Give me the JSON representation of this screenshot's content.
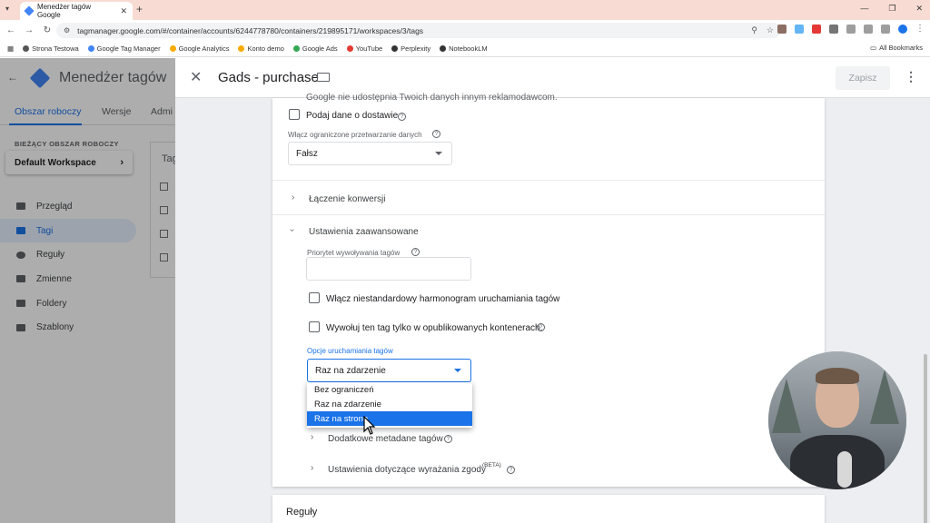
{
  "browser": {
    "tab_title": "Menedżer tagów Google",
    "url": "tagmanager.google.com/#/container/accounts/6244778780/containers/219895171/workspaces/3/tags",
    "bookmarks": [
      "Strona Testowa",
      "Google Tag Manager",
      "Google Analytics",
      "Konto demo",
      "Google Ads",
      "YouTube",
      "Perplexity",
      "NotebookLM"
    ],
    "all_bookmarks": "All Bookmarks"
  },
  "gtm": {
    "app_title": "Menedżer tagów",
    "tabs": [
      "Obszar roboczy",
      "Wersje",
      "Admi"
    ],
    "workspace_label": "BIEŻĄCY OBSZAR ROBOCZY",
    "workspace_name": "Default Workspace",
    "nav": [
      "Przegląd",
      "Tagi",
      "Reguły",
      "Zmienne",
      "Foldery",
      "Szablony"
    ],
    "tags_panel_title": "Tag"
  },
  "drawer": {
    "title": "Gads - purchase",
    "save_label": "Zapisz",
    "cut_text": "Google nie udostępnia Twoich danych innym reklamodawcom.",
    "delivery_label": "Podaj dane o dostawie",
    "restricted_label": "Włącz ograniczone przetwarzanie danych",
    "restricted_value": "Fałsz",
    "conversion_linking": "Łączenie konwersji",
    "advanced_settings": "Ustawienia zaawansowane",
    "priority_label": "Priorytet wywoływania tagów",
    "custom_schedule": "Włącz niestandardowy harmonogram uruchamiania tagów",
    "published_only": "Wywołuj ten tag tylko w opublikowanych kontenerach.",
    "firing_options_label": "Opcje uruchamiania tagów",
    "firing_options_value": "Raz na zdarzenie",
    "dropdown_options": [
      "Bez ograniczeń",
      "Raz na zdarzenie",
      "Raz na stronę"
    ],
    "additional_metadata": "Dodatkowe metadane tagów",
    "consent_settings": "Ustawienia dotyczące wyrażania zgody",
    "beta": "(BETA)",
    "triggers_title": "Reguły"
  }
}
